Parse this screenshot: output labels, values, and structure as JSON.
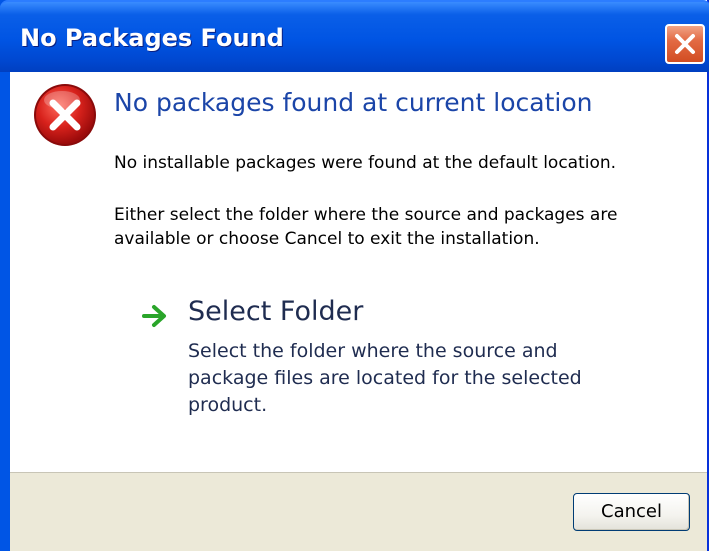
{
  "window": {
    "title": "No Packages Found"
  },
  "message": {
    "heading": "No packages found at current location",
    "paragraph1": "No installable packages were found at the default location.",
    "paragraph2": "Either select the folder where the source and packages are available or choose Cancel to exit the installation."
  },
  "option": {
    "title": "Select Folder",
    "description": "Select the folder where the source and package files are located for the selected product."
  },
  "footer": {
    "cancel_label": "Cancel"
  },
  "icons": {
    "error": "error-icon",
    "arrow": "arrow-right-icon",
    "close": "close-icon"
  },
  "colors": {
    "titlebar": "#0054e3",
    "heading": "#1b45a8",
    "error_red": "#d8221c",
    "arrow_green": "#2aa52a",
    "close_button": "#e0613a",
    "footer_bg": "#ece9d8"
  }
}
